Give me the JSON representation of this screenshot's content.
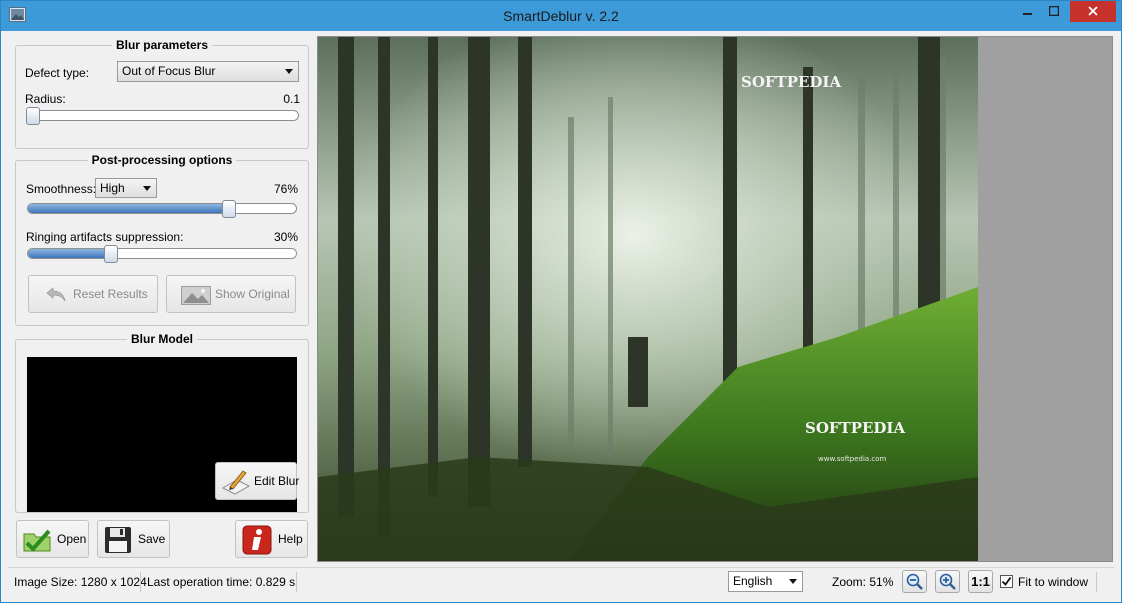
{
  "window": {
    "title": "SmartDeblur v. 2.2"
  },
  "blur_parameters": {
    "title": "Blur parameters",
    "defect_type_label": "Defect type:",
    "defect_type_value": "Out of Focus Blur",
    "radius_label": "Radius:",
    "radius_value": "0.1",
    "radius_fraction": 0.0
  },
  "post_processing": {
    "title": "Post-processing options",
    "smoothness_label": "Smoothness:",
    "smoothness_value": "High",
    "smoothness_percent": "76%",
    "smoothness_fraction": 0.76,
    "ringing_label": "Ringing artifacts suppression:",
    "ringing_percent": "30%",
    "ringing_fraction": 0.3,
    "reset_label": "Reset Results",
    "show_original_label": "Show Original"
  },
  "blur_model": {
    "title": "Blur Model",
    "edit_blur_label": "Edit Blur"
  },
  "actions": {
    "open_label": "Open",
    "save_label": "Save",
    "help_label": "Help"
  },
  "watermark": {
    "brand_top": "SOFTPEDIA",
    "brand_bottom": "SOFTPEDIA",
    "url": "www.softpedia.com"
  },
  "status": {
    "image_size": "Image Size: 1280 x 1024",
    "last_operation": "Last operation time: 0.829 s",
    "language": "English",
    "zoom": "Zoom: 51%",
    "one_to_one": "1:1",
    "fit_to_window_label": "Fit to window",
    "fit_to_window_checked": true
  },
  "colors": {
    "titlebar": "#3c9ad8",
    "close_button": "#c7312b",
    "slider_fill": "#3d75bd"
  }
}
